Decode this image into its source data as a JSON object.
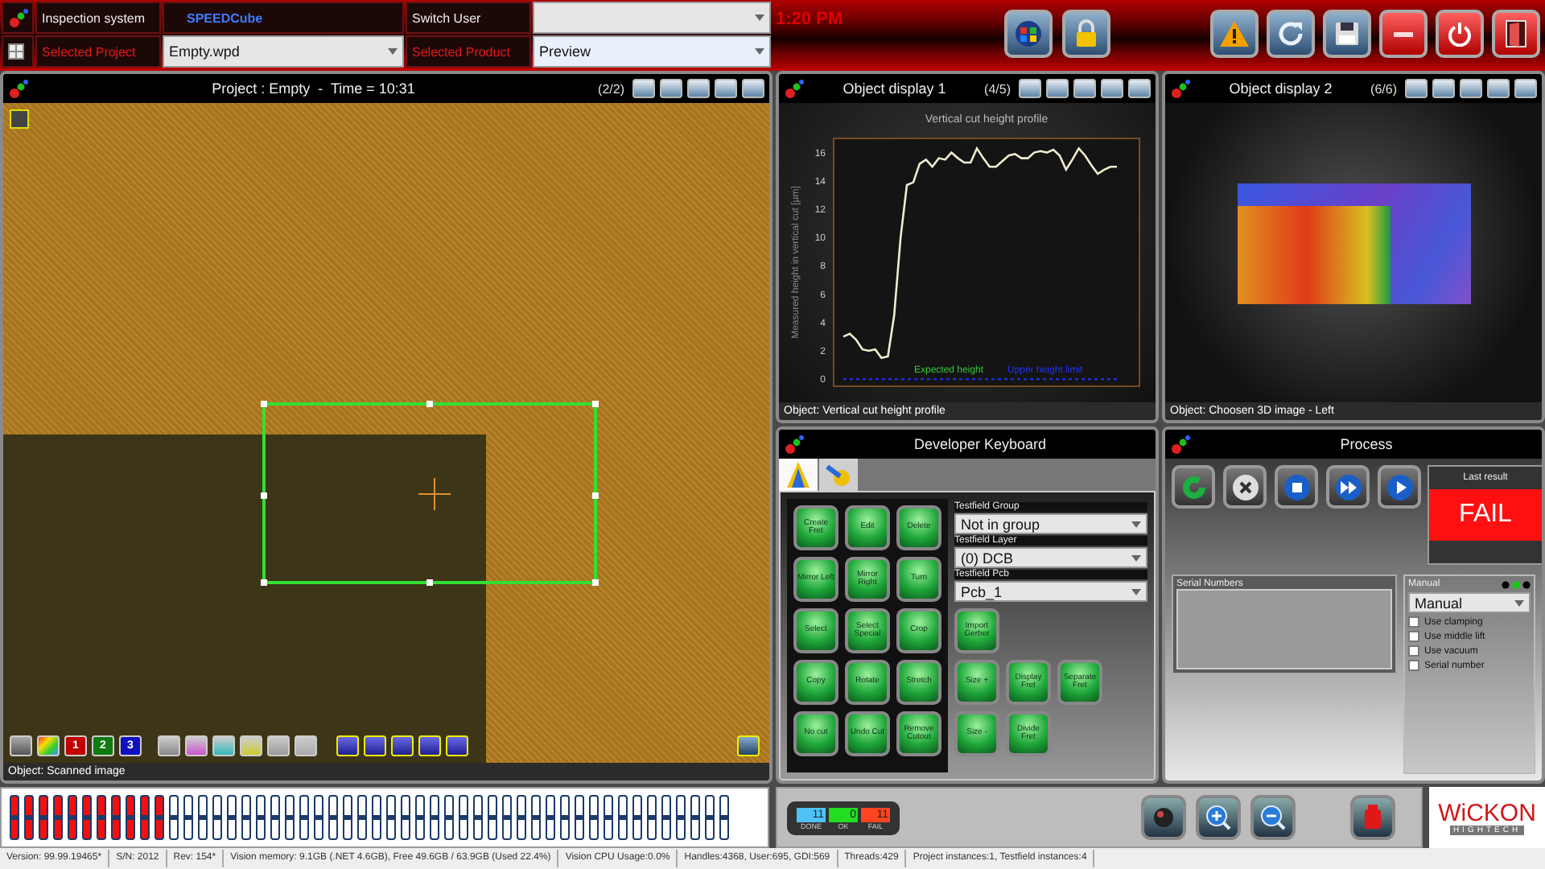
{
  "header": {
    "system_label": "Inspection system",
    "system_name": "SPEEDCube",
    "switch_user_label": "Switch User",
    "project_label": "Selected Project",
    "project_value": "Empty.wpd",
    "product_label": "Selected Product",
    "product_value": "Preview",
    "time": "1:20 PM"
  },
  "image_view": {
    "title": "Project : Empty  -  Time = 10:31",
    "count": "(2/2)",
    "footer": "Object: Scanned image",
    "channel_buttons": [
      {
        "label": "1",
        "color": "#c00000"
      },
      {
        "label": "2",
        "color": "#107a10"
      },
      {
        "label": "3",
        "color": "#1010c0"
      }
    ]
  },
  "display_1": {
    "title": "Object display 1",
    "count": "(4/5)",
    "footer": "Object: Vertical cut height profile",
    "chart_data": {
      "type": "line",
      "title": "Vertical cut height profile",
      "ylabel": "Measured height in vertical cut [µm]",
      "ylim": [
        -0.5,
        17
      ],
      "yticks": [
        0,
        2,
        4,
        6,
        8,
        10,
        12,
        14,
        16
      ],
      "series": [
        {
          "color": "#f0ecd0",
          "values": [
            3.0,
            3.2,
            2.8,
            2.1,
            2.0,
            2.1,
            1.5,
            1.6,
            4.5,
            10.0,
            13.7,
            13.9,
            15.2,
            15.5,
            15.0,
            15.6,
            15.5,
            16.0,
            15.6,
            15.3,
            15.3,
            16.3,
            15.6,
            15.0,
            15.0,
            15.4,
            15.8,
            15.9,
            15.6,
            15.6,
            16.0,
            16.1,
            16.0,
            16.2,
            15.8,
            14.8,
            15.5,
            16.3,
            15.8,
            15.1,
            14.5,
            14.8,
            15.0,
            15.0
          ]
        },
        {
          "name": "Upper height limit",
          "color": "#2233ff",
          "line_style": "dashed",
          "values": [
            0,
            0,
            0,
            0,
            0,
            0,
            0,
            0,
            0,
            0,
            0,
            0,
            0,
            0,
            0,
            0,
            0,
            0,
            0,
            0,
            0,
            0,
            0,
            0,
            0,
            0,
            0,
            0,
            0,
            0,
            0,
            0,
            0,
            0,
            0,
            0,
            0,
            0,
            0,
            0,
            0,
            0,
            0,
            0
          ]
        }
      ]
    },
    "legend": [
      {
        "label": "Expected height",
        "color": "#33cc33"
      }
    ]
  },
  "display_2": {
    "title": "Object display 2",
    "count": "(6/6)",
    "footer": "Object: Choosen 3D image - Left"
  },
  "keyboard": {
    "title": "Developer Keyboard",
    "tabs": [
      {
        "selected": true
      },
      {
        "selected": false
      }
    ],
    "left_buttons": [
      "Create Fret",
      "Edit",
      "Delete",
      "Mirror Left",
      "Mirror Right",
      "Turn",
      "Select",
      "Select Special",
      "Crop",
      "Copy",
      "Rotate",
      "Stretch",
      "No cut",
      "Undo Cut",
      "Remove Cutout"
    ],
    "fields": [
      {
        "label": "Testfield Group",
        "value": "Not in group"
      },
      {
        "label": "Testfield Layer",
        "value": "(0) DCB"
      },
      {
        "label": "Testfield Pcb",
        "value": "Pcb_1"
      }
    ],
    "right_buttons": [
      [
        "Import Gerber"
      ],
      [
        "Size +",
        "Display Fret",
        "Separate Fret"
      ],
      [
        "Size -",
        "Divide Fret"
      ]
    ]
  },
  "process": {
    "title": "Process",
    "last_result_label": "Last result",
    "last_result": "FAIL",
    "serial_label": "Serial Numbers",
    "mode_label": "Manual",
    "mode_value": "Manual",
    "options": [
      {
        "label": "Use clamping",
        "checked": false
      },
      {
        "label": "Use middle lift",
        "checked": false
      },
      {
        "label": "Use vacuum",
        "checked": false
      },
      {
        "label": "Serial number",
        "checked": false
      }
    ]
  },
  "progress": {
    "slots": [
      {
        "filled": true
      },
      {
        "filled": true
      },
      {
        "filled": true
      },
      {
        "filled": true
      },
      {
        "filled": true
      },
      {
        "filled": true
      },
      {
        "filled": true
      },
      {
        "filled": true
      },
      {
        "filled": true
      },
      {
        "filled": true
      },
      {
        "filled": true
      },
      {
        "filled": false
      },
      {
        "filled": false
      },
      {
        "filled": false
      },
      {
        "filled": false
      },
      {
        "filled": false
      },
      {
        "filled": false
      },
      {
        "filled": false
      },
      {
        "filled": false
      },
      {
        "filled": false
      },
      {
        "filled": false
      },
      {
        "filled": false
      },
      {
        "filled": false
      },
      {
        "filled": false
      },
      {
        "filled": false
      },
      {
        "filled": false
      },
      {
        "filled": false
      },
      {
        "filled": false
      },
      {
        "filled": false
      },
      {
        "filled": false
      },
      {
        "filled": false
      },
      {
        "filled": false
      },
      {
        "filled": false
      },
      {
        "filled": false
      },
      {
        "filled": false
      },
      {
        "filled": false
      },
      {
        "filled": false
      },
      {
        "filled": false
      },
      {
        "filled": false
      },
      {
        "filled": false
      },
      {
        "filled": false
      },
      {
        "filled": false
      },
      {
        "filled": false
      },
      {
        "filled": false
      },
      {
        "filled": false
      },
      {
        "filled": false
      },
      {
        "filled": false
      },
      {
        "filled": false
      },
      {
        "filled": false
      },
      {
        "filled": false
      }
    ]
  },
  "counters": [
    {
      "label": "DONE",
      "value": "11",
      "color": "#4fc3f7"
    },
    {
      "label": "OK",
      "value": "0",
      "color": "#22dd22"
    },
    {
      "label": "FAIL",
      "value": "11",
      "color": "#ff4422"
    }
  ],
  "logo": {
    "name": "WiCKON",
    "tagline": "HIGHTECH"
  },
  "status_bar": [
    "Version: 99.99.19465*",
    "S/N: 2012",
    "Rev: 154*",
    "Vision memory: 9.1GB (.NET 4.6GB), Free 49.6GB / 63.9GB (Used 22.4%)",
    "Vision CPU Usage:0.0%",
    "Handles:4368, User:695, GDI:569",
    "Threads:429",
    "Project instances:1, Testfield instances:4"
  ]
}
